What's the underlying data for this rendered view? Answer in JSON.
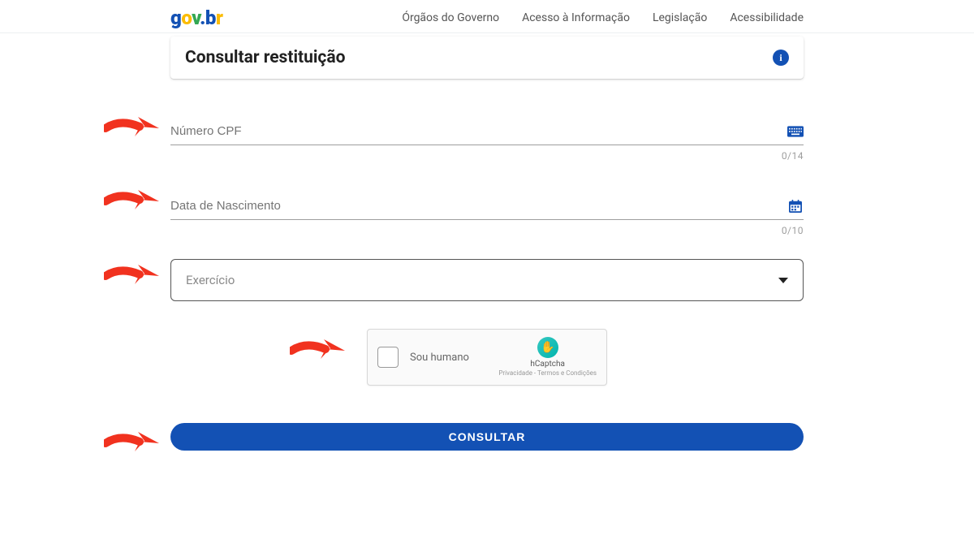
{
  "header": {
    "logo_text": "gov.br",
    "nav": [
      "Órgãos do Governo",
      "Acesso à Informação",
      "Legislação",
      "Acessibilidade"
    ]
  },
  "title": {
    "text": "Consultar restituição",
    "info_icon": "i"
  },
  "fields": {
    "cpf": {
      "label": "Número CPF",
      "counter": "0/14",
      "icon": "keyboard-icon",
      "value": ""
    },
    "dob": {
      "label": "Data de Nascimento",
      "counter": "0/10",
      "icon": "calendar-icon",
      "value": ""
    },
    "exercicio": {
      "label": "Exercício",
      "value": ""
    }
  },
  "captcha": {
    "label": "Sou humano",
    "brand": "hCaptcha",
    "terms": "Privacidade - Termos e Condições"
  },
  "submit": {
    "label": "CONSULTAR"
  },
  "colors": {
    "primary": "#1351b4",
    "annotation": "#f1321f"
  }
}
